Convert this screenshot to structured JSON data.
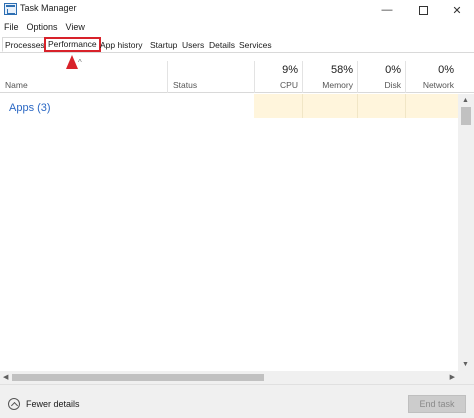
{
  "window": {
    "title": "Task Manager",
    "minimize_glyph": "—",
    "close_glyph": "✕"
  },
  "menu": {
    "items": [
      "File",
      "Options",
      "View"
    ]
  },
  "tabs": [
    {
      "label": "Processes",
      "active": true
    },
    {
      "label": "Performance",
      "highlighted": true
    },
    {
      "label": "App history"
    },
    {
      "label": "Startup"
    },
    {
      "label": "Users"
    },
    {
      "label": "Details"
    },
    {
      "label": "Services"
    }
  ],
  "sort_indicator": "^",
  "columns": {
    "name": {
      "label": "Name"
    },
    "status": {
      "label": "Status"
    },
    "cpu": {
      "percent": "9%",
      "label": "CPU"
    },
    "memory": {
      "percent": "58%",
      "label": "Memory"
    },
    "disk": {
      "percent": "0%",
      "label": "Disk"
    },
    "network": {
      "percent": "0%",
      "label": "Network"
    }
  },
  "groups": {
    "apps": "Apps (3)"
  },
  "scroll": {
    "up": "▲",
    "down": "▼",
    "left": "◀",
    "right": "▶"
  },
  "footer": {
    "fewer_details": "Fewer details",
    "end_task": "End task"
  },
  "colors": {
    "highlight_outline": "#d8222a",
    "group_title": "#2b68c4",
    "column_highlight": "#fff5dc"
  },
  "icons": {
    "app": "task-manager-icon",
    "fewer_details": "chevron-up-circle-icon",
    "annotation": "red-arrow-icon"
  }
}
